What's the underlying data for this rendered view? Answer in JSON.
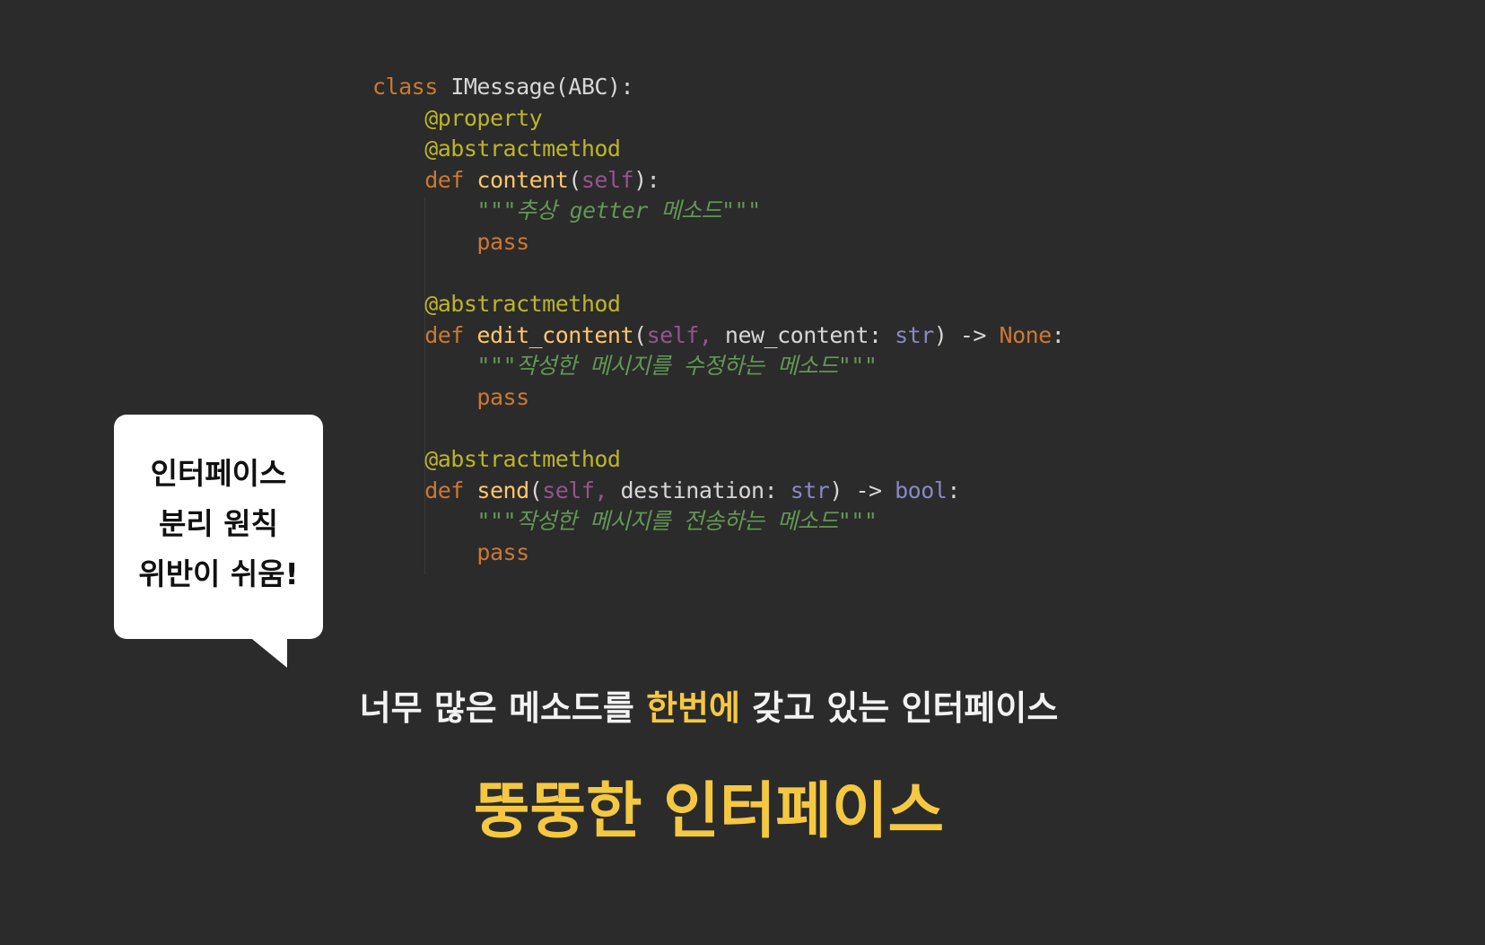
{
  "code": {
    "lines": [
      [
        {
          "t": "class ",
          "c": "kw"
        },
        {
          "t": "IMessage(ABC):",
          "c": "plain"
        }
      ],
      [
        {
          "t": "    @property",
          "c": "dec"
        }
      ],
      [
        {
          "t": "    @abstractmethod",
          "c": "dec"
        }
      ],
      [
        {
          "t": "    def ",
          "c": "kw"
        },
        {
          "t": "content",
          "c": "fn"
        },
        {
          "t": "(",
          "c": "plain"
        },
        {
          "t": "self",
          "c": "self"
        },
        {
          "t": "):",
          "c": "plain"
        }
      ],
      [
        {
          "t": "        \"\"\"추상 getter 메소드\"\"\"",
          "c": "doc"
        }
      ],
      [
        {
          "t": "        pass",
          "c": "kw"
        }
      ],
      [],
      [
        {
          "t": "    @abstractmethod",
          "c": "dec"
        }
      ],
      [
        {
          "t": "    def ",
          "c": "kw"
        },
        {
          "t": "edit_content",
          "c": "fn"
        },
        {
          "t": "(",
          "c": "plain"
        },
        {
          "t": "self, ",
          "c": "self"
        },
        {
          "t": "new_content: ",
          "c": "plain"
        },
        {
          "t": "str",
          "c": "builtin"
        },
        {
          "t": ") -> ",
          "c": "plain"
        },
        {
          "t": "None",
          "c": "kw"
        },
        {
          "t": ":",
          "c": "plain"
        }
      ],
      [
        {
          "t": "        \"\"\"작성한 메시지를 수정하는 메소드\"\"\"",
          "c": "doc"
        }
      ],
      [
        {
          "t": "        pass",
          "c": "kw"
        }
      ],
      [],
      [
        {
          "t": "    @abstractmethod",
          "c": "dec"
        }
      ],
      [
        {
          "t": "    def ",
          "c": "kw"
        },
        {
          "t": "send",
          "c": "fn"
        },
        {
          "t": "(",
          "c": "plain"
        },
        {
          "t": "self, ",
          "c": "self"
        },
        {
          "t": "destination: ",
          "c": "plain"
        },
        {
          "t": "str",
          "c": "builtin"
        },
        {
          "t": ") -> ",
          "c": "plain"
        },
        {
          "t": "bool",
          "c": "builtin"
        },
        {
          "t": ":",
          "c": "plain"
        }
      ],
      [
        {
          "t": "        \"\"\"작성한 메시지를 전송하는 메소드\"\"\"",
          "c": "doc"
        }
      ],
      [
        {
          "t": "        pass",
          "c": "kw"
        }
      ]
    ]
  },
  "bubble": {
    "line1": "인터페이스",
    "line2": "분리 원칙",
    "line3": "위반이 쉬움!"
  },
  "subtitle": {
    "part1": "너무 많은 메소드를 ",
    "highlight": "한번에",
    "part2": " 갖고 있는 인터페이스"
  },
  "headline": "뚱뚱한 인터페이스",
  "colors": {
    "background": "#2b2b2b",
    "keyword": "#cc7832",
    "decorator": "#bbb529",
    "function": "#ffc66d",
    "self": "#94558d",
    "builtin": "#8888c6",
    "docstring": "#629755",
    "highlight": "#f5c842"
  }
}
